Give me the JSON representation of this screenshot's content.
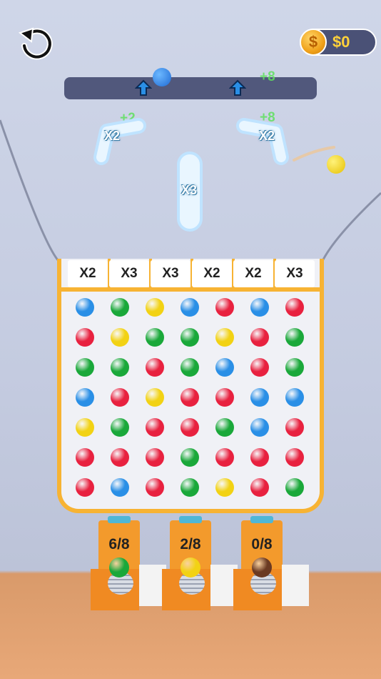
{
  "hud": {
    "money": "$0",
    "coin_symbol": "$"
  },
  "floating": {
    "top_right": "+8",
    "left": "+2",
    "right": "+8"
  },
  "bumpers": {
    "left": "X2",
    "right": "X2",
    "center": "X3"
  },
  "columns": [
    "X2",
    "X3",
    "X3",
    "X2",
    "X2",
    "X3"
  ],
  "grid": [
    [
      "blue",
      "green",
      "yellow",
      "blue",
      "red",
      "blue",
      "red"
    ],
    [
      "red",
      "yellow",
      "green",
      "green",
      "yellow",
      "red",
      "green"
    ],
    [
      "green",
      "green",
      "red",
      "green",
      "blue",
      "red",
      "green"
    ],
    [
      "blue",
      "red",
      "yellow",
      "red",
      "red",
      "blue",
      "blue"
    ],
    [
      "yellow",
      "green",
      "red",
      "red",
      "green",
      "blue",
      "red"
    ],
    [
      "red",
      "red",
      "red",
      "green",
      "red",
      "red",
      "red"
    ],
    [
      "red",
      "blue",
      "red",
      "green",
      "yellow",
      "red",
      "green"
    ]
  ],
  "bins": [
    {
      "count": "6/8",
      "ball": "green"
    },
    {
      "count": "2/8",
      "ball": "yellow"
    },
    {
      "count": "0/8",
      "ball": "brown"
    }
  ],
  "colors": {
    "red": "#e8213f",
    "green": "#1aa83a",
    "blue": "#2a8fe6",
    "yellow": "#f2d214",
    "brown": "#6b3a22"
  }
}
